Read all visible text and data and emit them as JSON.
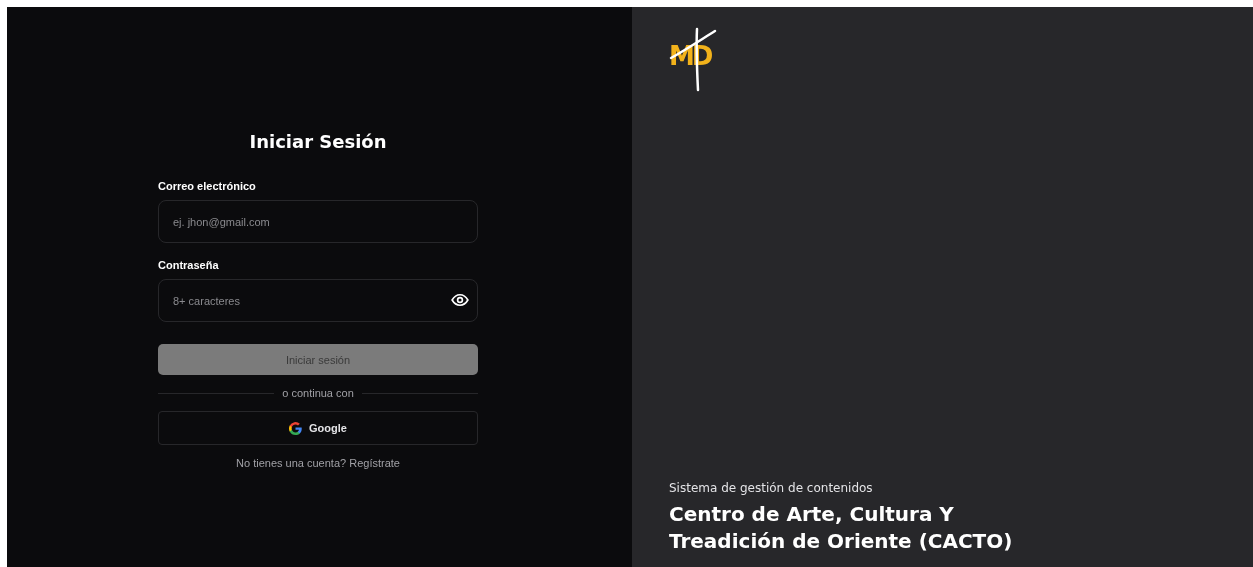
{
  "login": {
    "title": "Iniciar Sesión",
    "fields": [
      {
        "kind": "email",
        "label": "Correo electrónico",
        "placeholder": "ej. jhon@gmail.com"
      },
      {
        "kind": "password",
        "label": "Contraseña",
        "placeholder": "8+ caracteres"
      }
    ],
    "submit": {
      "label": "Iniciar sesión",
      "disabled": true
    },
    "divider": "o continua con",
    "google_button": {
      "label": "Google"
    },
    "signup": {
      "prompt": "No tienes una cuenta?",
      "link": "Regístrate"
    }
  },
  "brand": {
    "logo": "MD",
    "subtitle": "Sistema de gestión de contenidos",
    "title": "Centro de Arte, Cultura Y Treadición de Oriente (CACTO)"
  }
}
